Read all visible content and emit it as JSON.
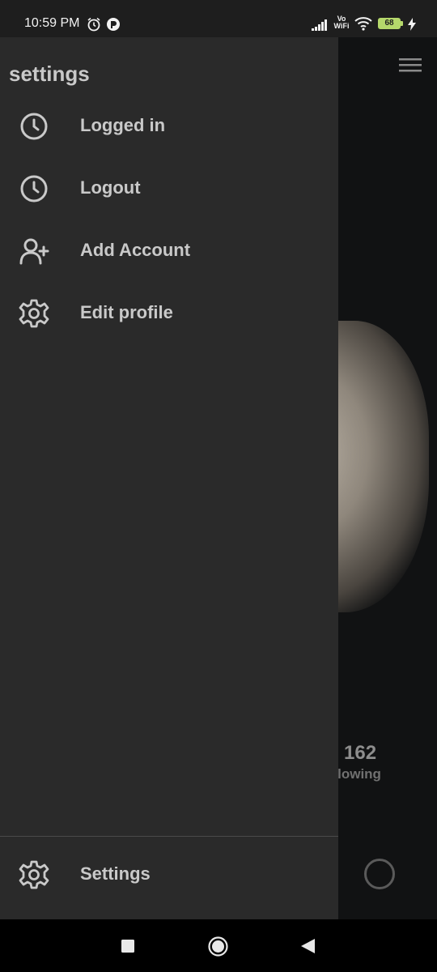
{
  "status_bar": {
    "time": "10:59 PM",
    "icons": [
      "alarm-icon",
      "app-notification-icon",
      "signal-icon",
      "vowifi-icon",
      "wifi-icon",
      "battery-icon",
      "charging-icon"
    ],
    "vowifi_top": "Vo",
    "vowifi_bottom": "WiFi",
    "battery": "68"
  },
  "drawer": {
    "title": "settings",
    "items": [
      {
        "label": "Logged in",
        "icon": "clock-icon"
      },
      {
        "label": "Logout",
        "icon": "clock-icon"
      },
      {
        "label": "Add Account",
        "icon": "add-person-icon"
      },
      {
        "label": "Edit profile",
        "icon": "gear-icon"
      }
    ],
    "footer_item": {
      "label": "Settings",
      "icon": "gear-icon"
    }
  },
  "background": {
    "stat_number": "162",
    "stat_label": "ollowing"
  },
  "nav_bar": {
    "icons": [
      "recents-square-icon",
      "home-circle-icon",
      "back-triangle-icon"
    ]
  }
}
